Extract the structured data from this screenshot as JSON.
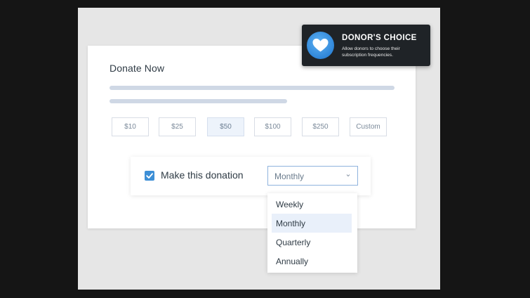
{
  "card": {
    "title": "Donate Now",
    "amounts": [
      {
        "label": "$10",
        "selected": false
      },
      {
        "label": "$25",
        "selected": false
      },
      {
        "label": "$50",
        "selected": true
      },
      {
        "label": "$100",
        "selected": false
      },
      {
        "label": "$250",
        "selected": false
      },
      {
        "label": "Custom",
        "selected": false
      }
    ]
  },
  "recurring": {
    "checked": true,
    "label": "Make this donation",
    "frequency": {
      "selected": "Monthly",
      "options": [
        "Weekly",
        "Monthly",
        "Quarterly",
        "Annually"
      ],
      "highlighted": "Monthly"
    }
  },
  "tooltip": {
    "title": "DONOR'S CHOICE",
    "description": "Allow donors to choose their subscription frequencies.",
    "icon": "heart-icon"
  },
  "colors": {
    "accent": "#3d8fd6",
    "skeleton": "#cfd8e5",
    "tooltip_bg": "#1f2327",
    "selected_amount_bg": "#edf3fb"
  }
}
